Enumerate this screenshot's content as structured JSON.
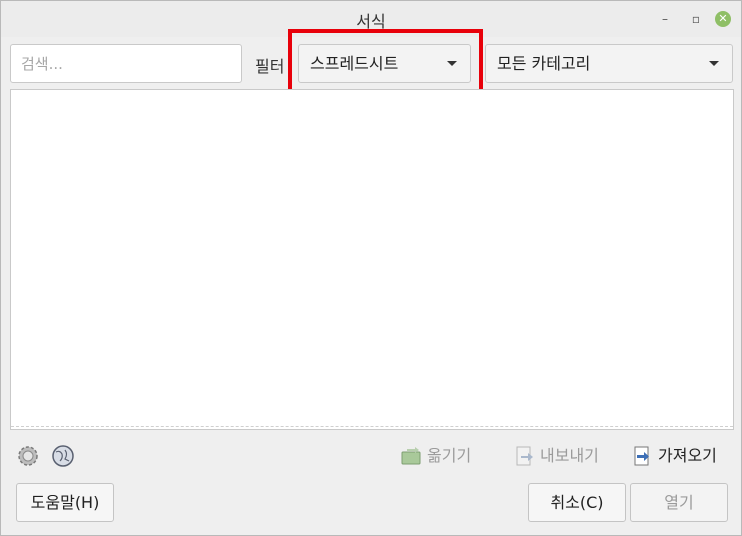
{
  "window": {
    "title": "서식"
  },
  "controls": {
    "minimize": "–",
    "maximize": "▫",
    "close": "✕"
  },
  "toolbar": {
    "search_placeholder": "검색...",
    "filter_label": "필터",
    "filter_value": "스프레드시트",
    "category_value": "모든 카테고리"
  },
  "actions": {
    "move": "옮기기",
    "export": "내보내기",
    "import": "가져오기"
  },
  "buttons": {
    "help": "도움말(H)",
    "cancel": "취소(C)",
    "open": "열기"
  },
  "colors": {
    "highlight": "#e8000a",
    "close_button": "#8fbf66"
  }
}
